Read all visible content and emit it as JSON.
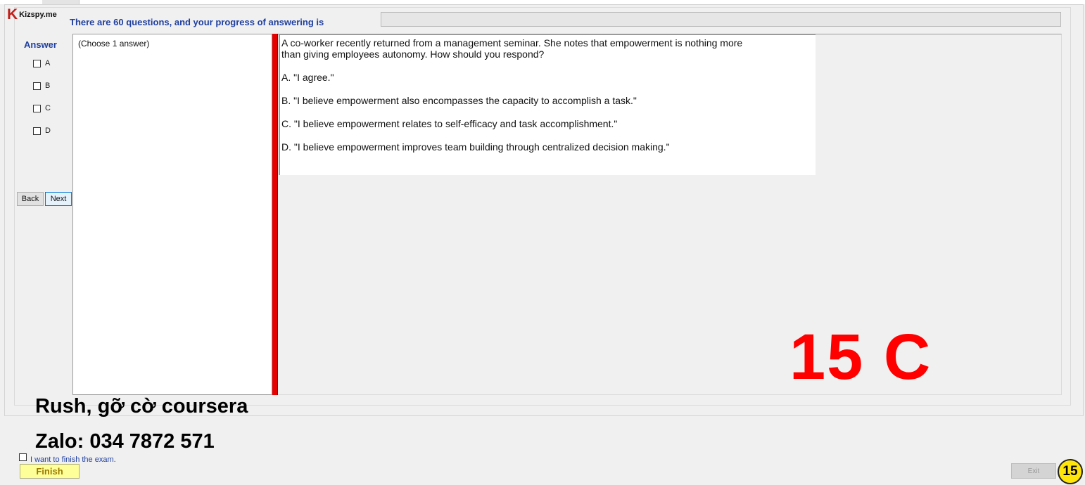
{
  "app": {
    "logo_letter": "K",
    "logo_text": "Kizspy.me"
  },
  "header": {
    "progress_label": "There are 60 questions, and your progress of answering is",
    "progress_fraction": 0
  },
  "answer_panel": {
    "title": "Answer",
    "options": [
      "A",
      "B",
      "C",
      "D"
    ],
    "back_label": "Back",
    "next_label": "Next"
  },
  "choose_panel": {
    "hint": "(Choose 1 answer)"
  },
  "question": {
    "stem_line1": "A co-worker recently returned from a management seminar. She notes that empowerment is nothing more",
    "stem_line2": "than giving employees autonomy. How should you respond?",
    "options": [
      "A.  \"I agree.\"",
      "B.  \"I believe empowerment also encompasses the capacity to accomplish a task.\"",
      "C.  \"I believe empowerment relates to self-efficacy and task accomplishment.\"",
      "D.  \"I believe empowerment improves team building through centralized decision making.\""
    ]
  },
  "overlay": {
    "answer_mark": "15 C",
    "line1": "Rush, gỡ cờ coursera",
    "line2": "Zalo: 034 7872 571",
    "badge": "15"
  },
  "footer": {
    "finish_check_label": "I want to finish the exam.",
    "finish_label": "Finish",
    "exit_label": "Exit"
  },
  "colors": {
    "accent_blue": "#1f3f9f",
    "splitter_red": "#e60000",
    "answer_red": "#ff0000",
    "finish_yellow": "#ffff99",
    "badge_yellow": "#ffe60a"
  }
}
